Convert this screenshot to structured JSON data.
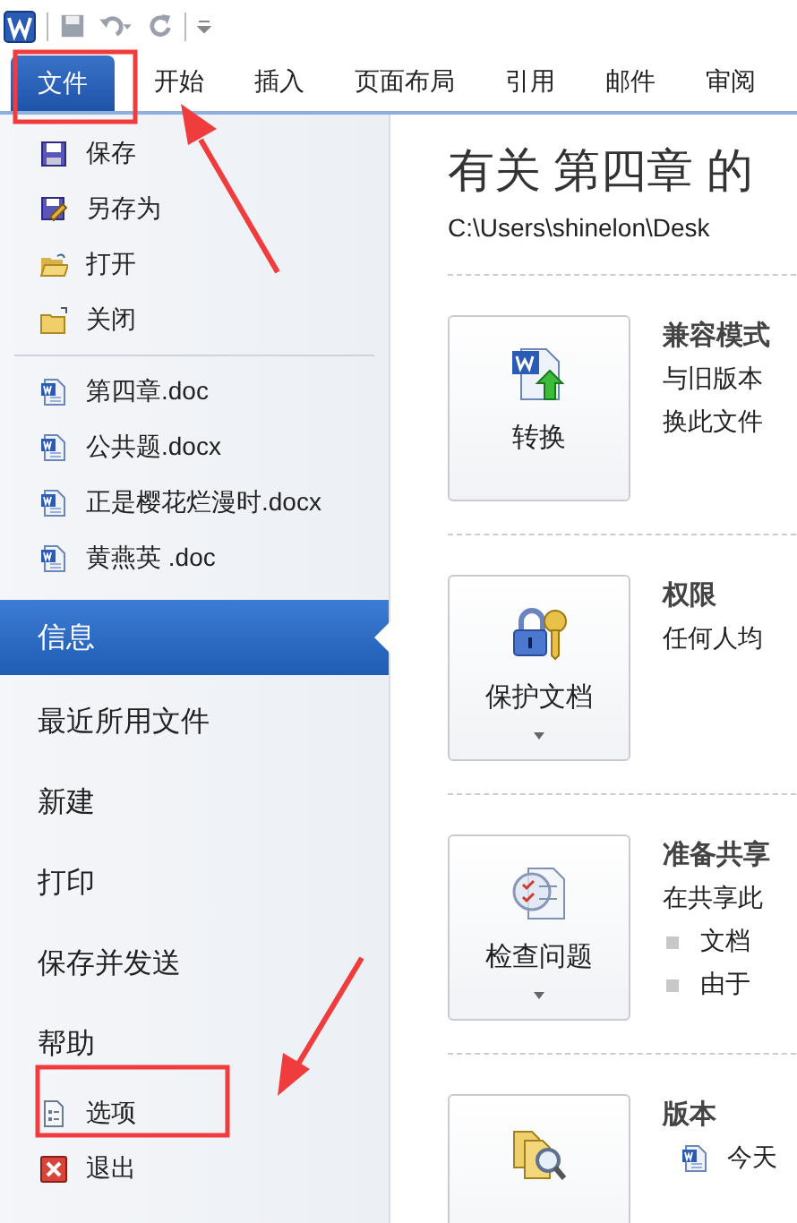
{
  "ribbon": {
    "tabs": [
      {
        "label": "文件",
        "selected": true
      },
      {
        "label": "开始",
        "selected": false
      },
      {
        "label": "插入",
        "selected": false
      },
      {
        "label": "页面布局",
        "selected": false
      },
      {
        "label": "引用",
        "selected": false
      },
      {
        "label": "邮件",
        "selected": false
      },
      {
        "label": "审阅",
        "selected": false
      }
    ]
  },
  "backstage": {
    "commands": [
      {
        "label": "保存"
      },
      {
        "label": "另存为"
      },
      {
        "label": "打开"
      },
      {
        "label": "关闭"
      }
    ],
    "recent_files": [
      {
        "label": "第四章.doc"
      },
      {
        "label": "公共题.docx"
      },
      {
        "label": "正是樱花烂漫时.docx"
      },
      {
        "label": "黄燕英 .doc"
      }
    ],
    "nav": [
      {
        "label": "信息",
        "selected": true
      },
      {
        "label": "最近所用文件",
        "selected": false
      },
      {
        "label": "新建",
        "selected": false
      },
      {
        "label": "打印",
        "selected": false
      },
      {
        "label": "保存并发送",
        "selected": false
      },
      {
        "label": "帮助",
        "selected": false
      }
    ],
    "footer_commands": [
      {
        "label": "选项"
      },
      {
        "label": "退出"
      }
    ]
  },
  "info": {
    "title": "有关 第四章 的",
    "path": "C:\\Users\\shinelon\\Desk",
    "sections": [
      {
        "button": "转换",
        "dropdown": false,
        "heading": "兼容模式",
        "lines": [
          "与旧版本",
          "换此文件"
        ]
      },
      {
        "button": "保护文档",
        "dropdown": true,
        "heading": "权限",
        "lines": [
          "任何人均"
        ]
      },
      {
        "button": "检查问题",
        "dropdown": true,
        "heading": "准备共享",
        "lines": [
          "在共享此"
        ],
        "bullets": [
          "文档",
          "由于"
        ]
      },
      {
        "heading": "版本",
        "versions": [
          "今天"
        ]
      }
    ]
  }
}
